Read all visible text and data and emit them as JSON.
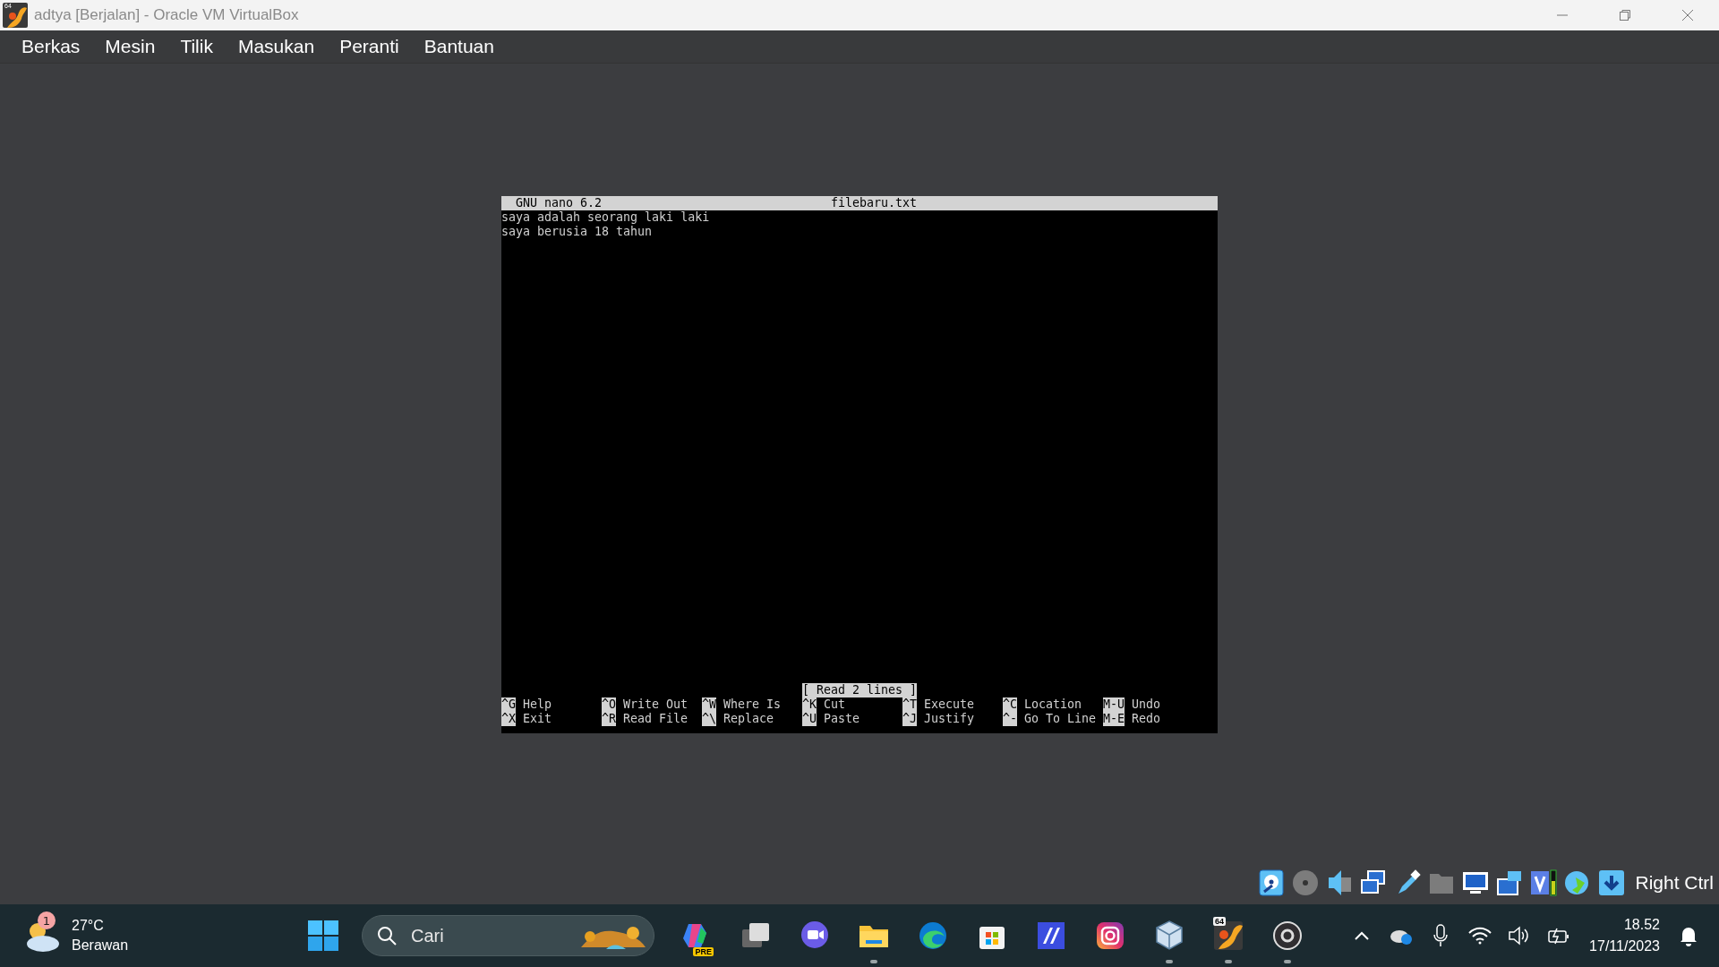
{
  "window": {
    "title": "adtya [Berjalan] - Oracle VM VirtualBox",
    "icon_badge": "64"
  },
  "menu": [
    "Berkas",
    "Mesin",
    "Tilik",
    "Masukan",
    "Peranti",
    "Bantuan"
  ],
  "nano": {
    "version": "GNU nano 6.2",
    "filename": "filebaru.txt",
    "lines": [
      "saya adalah seorang laki laki",
      "saya berusia 18 tahun"
    ],
    "status": "[ Read 2 lines ]",
    "shortcut_rows": [
      [
        {
          "key": "^G",
          "label": "Help"
        },
        {
          "key": "^O",
          "label": "Write Out"
        },
        {
          "key": "^W",
          "label": "Where Is"
        },
        {
          "key": "^K",
          "label": "Cut"
        },
        {
          "key": "^T",
          "label": "Execute"
        },
        {
          "key": "^C",
          "label": "Location"
        },
        {
          "key": "M-U",
          "label": "Undo"
        }
      ],
      [
        {
          "key": "^X",
          "label": "Exit"
        },
        {
          "key": "^R",
          "label": "Read File"
        },
        {
          "key": "^\\",
          "label": "Replace"
        },
        {
          "key": "^U",
          "label": "Paste"
        },
        {
          "key": "^J",
          "label": "Justify"
        },
        {
          "key": "^-",
          "label": "Go To Line"
        },
        {
          "key": "M-E",
          "label": "Redo"
        }
      ]
    ]
  },
  "host_key": "Right Ctrl",
  "taskbar": {
    "weather": {
      "badge": "1",
      "temperature": "27°C",
      "condition": "Berawan"
    },
    "search": {
      "placeholder": "Cari"
    },
    "apps": [
      {
        "kind": "copilot",
        "badge": "PRE",
        "running": false
      },
      {
        "kind": "taskview",
        "running": false
      },
      {
        "kind": "meet",
        "running": false
      },
      {
        "kind": "explorer",
        "running": true
      },
      {
        "kind": "edge",
        "running": false
      },
      {
        "kind": "store",
        "running": false
      },
      {
        "kind": "editor",
        "running": false
      },
      {
        "kind": "instagram",
        "running": false
      },
      {
        "kind": "cube",
        "running": true
      },
      {
        "kind": "virtualbox",
        "badge": "64",
        "running": true
      },
      {
        "kind": "obs",
        "running": true
      }
    ],
    "clock": {
      "time": "18.52",
      "date": "17/11/2023"
    }
  }
}
